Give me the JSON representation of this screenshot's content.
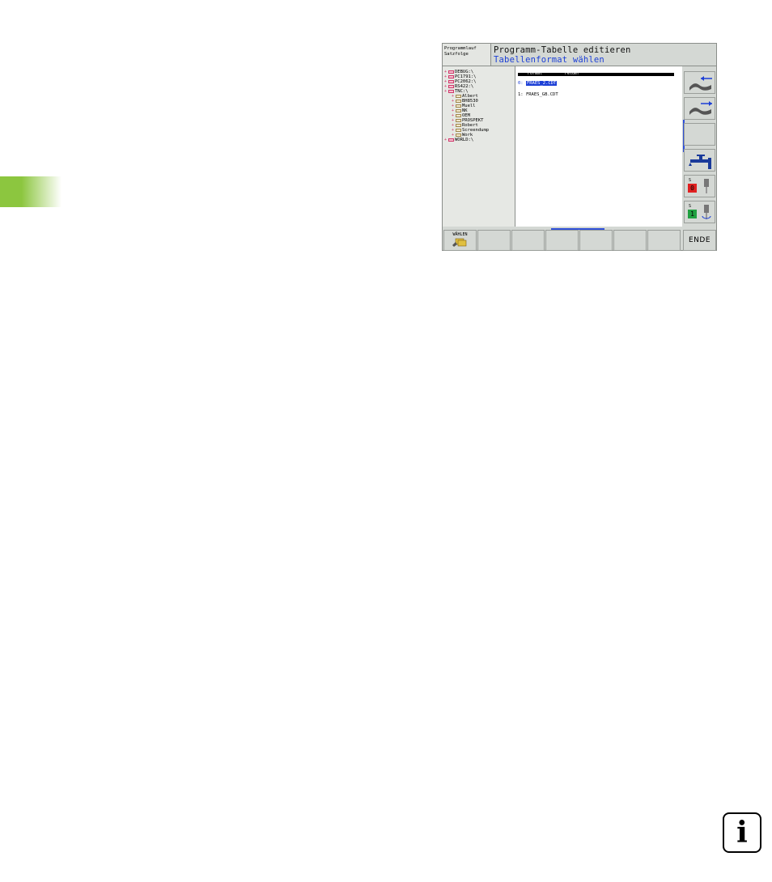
{
  "header": {
    "mode_line1": "Programmlauf",
    "mode_line2": "Satzfolge",
    "title": "Programm-Tabelle editieren",
    "subtitle": "Tabellenformat wählen"
  },
  "tree": {
    "items": [
      {
        "label": "DEBUG:\\",
        "icon": "drive-icon",
        "level": 0
      },
      {
        "label": "PC1791:\\",
        "icon": "drive-icon",
        "level": 0
      },
      {
        "label": "PC2062:\\",
        "icon": "drive-icon",
        "level": 0
      },
      {
        "label": "RS422:\\",
        "icon": "drive-icon",
        "level": 0
      },
      {
        "label": "TNC:\\",
        "icon": "drive-icon",
        "level": 0
      },
      {
        "label": "Albert",
        "icon": "folder-icon",
        "level": 1
      },
      {
        "label": "BH8530",
        "icon": "folder-icon",
        "level": 1
      },
      {
        "label": "Muell",
        "icon": "folder-icon",
        "level": 1
      },
      {
        "label": "NK",
        "icon": "folder-icon",
        "level": 1
      },
      {
        "label": "OEM",
        "icon": "folder-icon",
        "level": 1
      },
      {
        "label": "PROSPEKT",
        "icon": "folder-icon",
        "level": 1
      },
      {
        "label": "Robert",
        "icon": "folder-icon",
        "level": 1
      },
      {
        "label": "Screendump",
        "icon": "folder-icon",
        "level": 1
      },
      {
        "label": "Work",
        "icon": "folder-icon",
        "level": 1
      },
      {
        "label": "WORLD:\\",
        "icon": "drive-icon",
        "level": 0
      }
    ]
  },
  "list": {
    "col_format": "Format",
    "col_fields": "Felder",
    "rows": [
      {
        "index": "0:",
        "name": "FRAES_2.CDT",
        "selected": true
      },
      {
        "index": "1:",
        "name": "FRAES_GB.CDT",
        "selected": false
      }
    ]
  },
  "softkeys": {
    "waehlen": "WÄHLEN",
    "ende": "ENDE",
    "side": [
      "page-up-icon",
      "page-down-icon",
      "blank",
      "feed-icon",
      "spindle-off-icon",
      "spindle-on-icon"
    ],
    "side_labels": {
      "s4_top": "S",
      "s4_val": "0",
      "s5_top": "S",
      "s5_val": "1"
    }
  },
  "page": {
    "info_glyph": "i"
  },
  "colors": {
    "accent_blue": "#1c3fd6",
    "tab_green": "#8cc63f",
    "drive_pink": "#d0386a"
  }
}
